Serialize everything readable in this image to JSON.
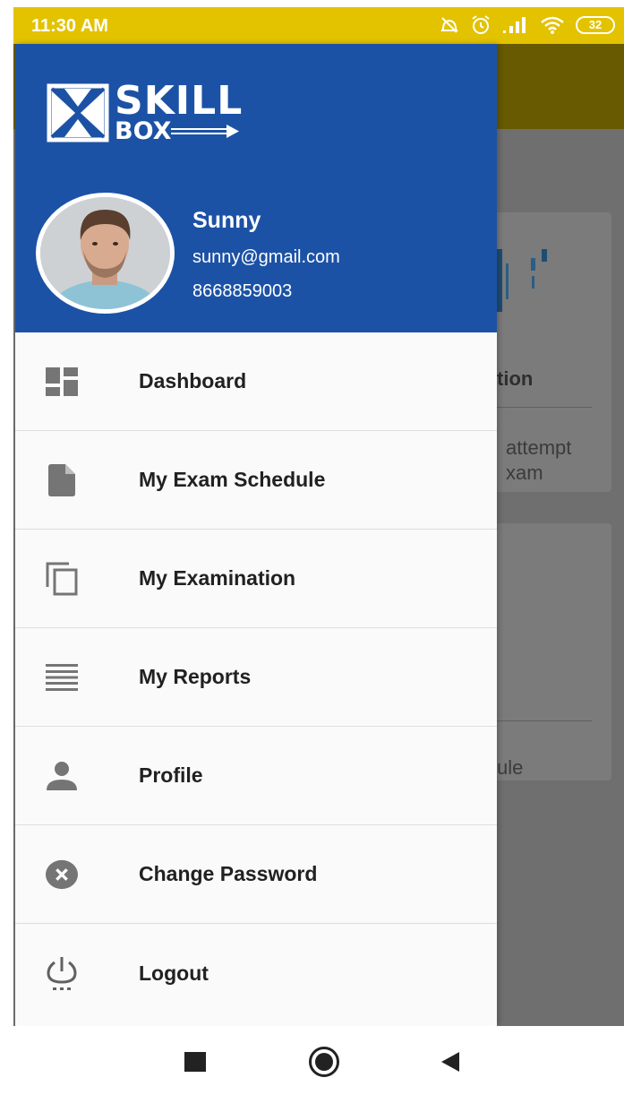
{
  "status_bar": {
    "time": "11:30 AM",
    "battery": "32",
    "icons": [
      "do-not-disturb-icon",
      "alarm-icon",
      "signal-icon",
      "wifi-icon",
      "battery-icon"
    ]
  },
  "background": {
    "card1_title_fragment": "tion",
    "card1_desc_line1": "attempt",
    "card1_desc_line2": "xam",
    "card2_desc_fragment": "ule"
  },
  "drawer": {
    "logo": {
      "word1": "SKILL",
      "word2": "BOX"
    },
    "user": {
      "name": "Sunny",
      "email": "sunny@gmail.com",
      "phone": "8668859003"
    },
    "menu": [
      {
        "label": "Dashboard",
        "icon": "dashboard-icon"
      },
      {
        "label": "My Exam Schedule",
        "icon": "document-icon"
      },
      {
        "label": "My Examination",
        "icon": "copy-icon"
      },
      {
        "label": "My Reports",
        "icon": "list-lines-icon"
      },
      {
        "label": "Profile",
        "icon": "person-icon"
      },
      {
        "label": "Change Password",
        "icon": "cancel-circle-icon"
      },
      {
        "label": "Logout",
        "icon": "power-icon"
      }
    ]
  },
  "colors": {
    "status_bar": "#e3c200",
    "drawer_header": "#1c52a5",
    "icon_gray": "#757575",
    "menu_text": "#212121"
  }
}
